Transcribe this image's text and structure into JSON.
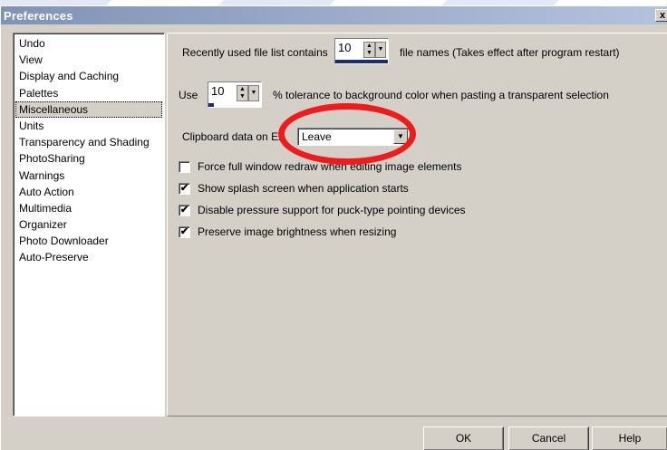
{
  "window": {
    "title": "Preferences",
    "close_glyph": "x"
  },
  "categories": [
    "Undo",
    "View",
    "Display and Caching",
    "Palettes",
    "Miscellaneous",
    "Units",
    "Transparency and Shading",
    "PhotoSharing",
    "Warnings",
    "Auto Action",
    "Multimedia",
    "Organizer",
    "Photo Downloader",
    "Auto-Preserve"
  ],
  "selected_category": "Miscellaneous",
  "misc": {
    "recent_files": {
      "label_before": "Recently used file list contains",
      "value": "10",
      "label_after": "file names (Takes effect after program restart)"
    },
    "tolerance": {
      "label_before": "Use",
      "value": "10",
      "label_after": "% tolerance to background color when pasting a transparent selection"
    },
    "clipboard": {
      "label": "Clipboard data on Ex",
      "value": "Leave"
    },
    "checkboxes": [
      {
        "label": "Force full window redraw when editing image elements",
        "checked": false
      },
      {
        "label": "Show splash screen when application starts",
        "checked": true
      },
      {
        "label": "Disable pressure support for puck-type pointing devices",
        "checked": true
      },
      {
        "label": "Preserve image brightness when resizing",
        "checked": true
      }
    ]
  },
  "buttons": {
    "ok": "OK",
    "cancel": "Cancel",
    "help": "Help"
  },
  "colors": {
    "annotation_oval": "#ee1c1c",
    "title_bar": "#8193b5"
  },
  "icons": {
    "checkmark": "✔",
    "spin_up": "▲",
    "spin_down": "▼",
    "dropdown": "▼"
  }
}
